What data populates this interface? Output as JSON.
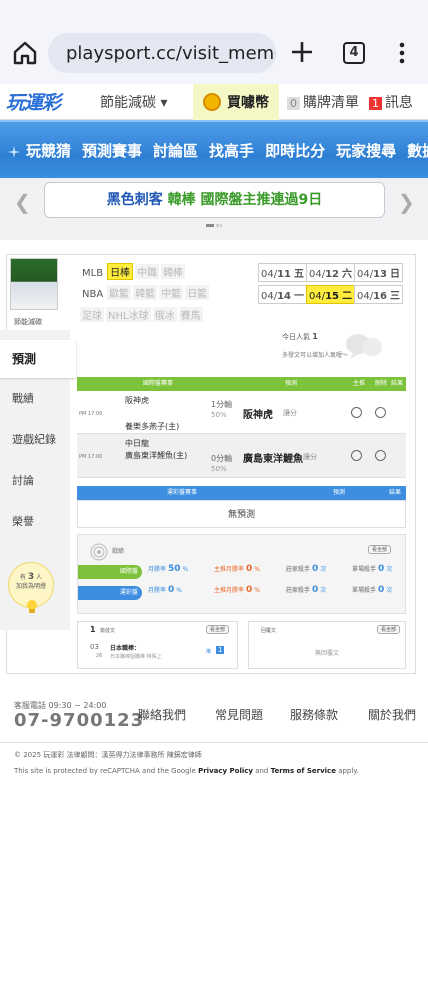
{
  "browser": {
    "url": "playsport.cc/visit_membe",
    "tab_count": "4"
  },
  "site": {
    "logo": "玩運彩",
    "eco_menu": "節能減碳 ▾",
    "coins": "買噱幣",
    "cart_count": "0",
    "cart": "購牌清單",
    "msg_count": "1",
    "msg": "訊息"
  },
  "nav": [
    "玩競猜",
    "預測賽事",
    "討論區",
    "找高手",
    "即時比分",
    "玩家搜尋",
    "數據"
  ],
  "banner": {
    "part1": "黑色刺客",
    "part2": "韓棒 國際盤主推連過9日"
  },
  "profile": {
    "name": "節能減碳",
    "sidebar": [
      "預測",
      "戰績",
      "遊戲紀錄",
      "討論",
      "榮譽"
    ],
    "helper_line1": "有",
    "helper_count": "3",
    "helper_line2": "人",
    "helper_line3": "加我為明燈"
  },
  "leagues": {
    "row1": [
      {
        "t": "MLB",
        "on": false,
        "plain": true
      },
      {
        "t": "日棒",
        "on": true
      },
      {
        "t": "中職",
        "on": false
      },
      {
        "t": "韓棒",
        "on": false
      }
    ],
    "row2": [
      {
        "t": "NBA",
        "on": false,
        "plain": true
      },
      {
        "t": "歐籃",
        "on": false
      },
      {
        "t": "韓籃",
        "on": false
      },
      {
        "t": "中籃",
        "on": false
      },
      {
        "t": "日籃",
        "on": false
      }
    ],
    "row3": [
      {
        "t": "足球",
        "on": false
      },
      {
        "t": "NHL冰球",
        "on": false
      },
      {
        "t": "俄冰",
        "on": false
      },
      {
        "t": "賽馬",
        "on": false
      }
    ]
  },
  "dates": {
    "row1": [
      {
        "d": "04/",
        "b": "11",
        "w": "五",
        "on": false
      },
      {
        "d": "04/",
        "b": "12",
        "w": "六",
        "on": false
      },
      {
        "d": "04/",
        "b": "13",
        "w": "日",
        "on": false
      }
    ],
    "row2": [
      {
        "d": "04/",
        "b": "14",
        "w": "一",
        "on": false
      },
      {
        "d": "04/",
        "b": "15",
        "w": "二",
        "on": true
      },
      {
        "d": "04/",
        "b": "16",
        "w": "三",
        "on": false
      }
    ]
  },
  "today": {
    "label": "今日人氣",
    "value": "1",
    "hint": "多發文可以增加人氣喔～"
  },
  "intl_table": {
    "headers": [
      "國際盤賽事",
      "預測",
      "主推",
      "刪除",
      "結果"
    ],
    "rows": [
      {
        "time": "PM 17:00",
        "home": "阪神虎",
        "away": "養樂多燕子(主)",
        "line": "1分輸",
        "pct": "50%",
        "pick": "阪神虎",
        "pick_note": "讓分"
      },
      {
        "time": "PM 17:00",
        "home": "中日龍",
        "away": "廣島東洋鯉魚(主)",
        "line": "0分輸",
        "pct": "50%",
        "pick": "廣島東洋鯉魚",
        "pick_note": "讓分"
      }
    ]
  },
  "local_table": {
    "headers": [
      "運彩盤賽事",
      "預測",
      "結果"
    ],
    "empty": "無預測"
  },
  "stats": {
    "title": "戰績",
    "all": "看全部",
    "rows": [
      {
        "name": "國際盤",
        "month": "月勝率",
        "month_v": "50",
        "pct": "%",
        "main": "主推月勝率",
        "main_v": "0",
        "main_pct": "%",
        "kill": "莊家殺手",
        "kill_v": "0",
        "kill_u": "次",
        "single": "單場殺手",
        "single_v": "0",
        "single_u": "次"
      },
      {
        "name": "運彩盤",
        "month": "月勝率",
        "month_v": "0",
        "pct": "%",
        "main": "主推月勝率",
        "main_v": "0",
        "main_pct": "%",
        "kill": "莊家殺手",
        "kill_v": "0",
        "kill_u": "次",
        "single": "單場殺手",
        "single_v": "0",
        "single_u": "次"
      }
    ]
  },
  "posts": {
    "count": "1",
    "label": "篇發文",
    "all": "看全部",
    "date_m": "03",
    "date_d": "26",
    "title": "日本職棒：",
    "sub": "日本職棒個職棒 特殊上",
    "reply_label": "推",
    "reply_count": "1"
  },
  "replies": {
    "label": "回覆文",
    "all": "看全部",
    "empty": "無回覆文"
  },
  "footer": {
    "hours": "客服電話 09:30 ~ 24:00",
    "phone": "07-9700123",
    "links": [
      "聯絡我們",
      "常見問題",
      "服務條款",
      "關於我們"
    ],
    "copyright": "© 2025 玩運彩 法律顧問：漢英得力法律事務所 陳鎬宏律師",
    "recaptcha_pre": "This site is protected by reCAPTCHA and the Google",
    "privacy": "Privacy Policy",
    "and": "and",
    "terms": "Terms of Service",
    "apply": "apply."
  },
  "colors": {
    "nav": "#2e7fd4",
    "green": "#7cc23a",
    "blue": "#3d8ee0",
    "yellow": "#ffec3d",
    "red": "#e33"
  }
}
